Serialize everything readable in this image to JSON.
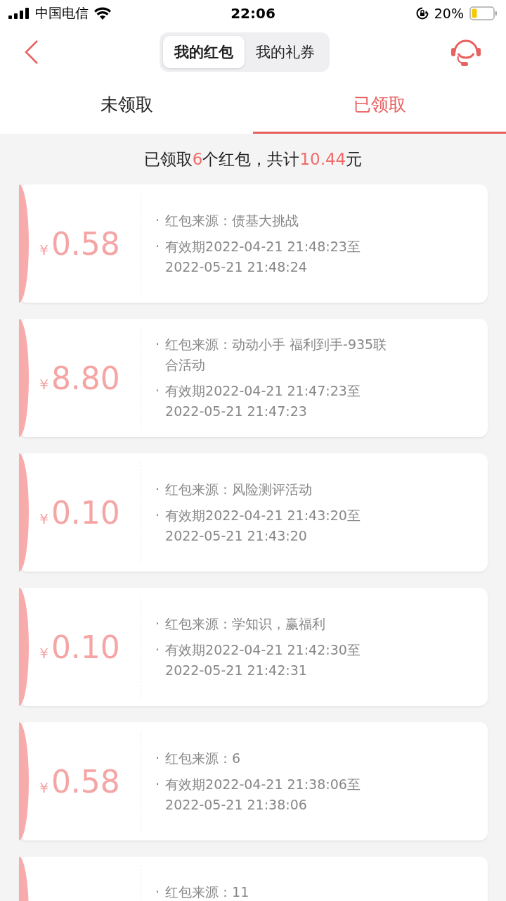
{
  "status_bar": {
    "carrier": "中国电信",
    "time": "22:06",
    "battery": "20%"
  },
  "segments": [
    {
      "label": "我的红包",
      "selected": true
    },
    {
      "label": "我的礼券",
      "selected": false
    }
  ],
  "tabs": [
    {
      "label": "未领取",
      "selected": false
    },
    {
      "label": "已领取",
      "selected": true
    }
  ],
  "summary": [
    {
      "text": "已领取",
      "highlight": false
    },
    {
      "text": "6",
      "highlight": true
    },
    {
      "text": "个红包，共计",
      "highlight": false
    },
    {
      "text": "10.44",
      "highlight": true
    },
    {
      "text": "元",
      "highlight": false
    }
  ],
  "cards": [
    {
      "currency": "¥",
      "amount": "0.58",
      "lines": [
        {
          "bullet": "·",
          "text": "红包来源：债基大挑战"
        },
        {
          "bullet": "·",
          "text": "有效期2022-04-21 21:48:23至 2022-05-21 21:48:24"
        }
      ]
    },
    {
      "currency": "¥",
      "amount": "8.80",
      "lines": [
        {
          "bullet": "·",
          "text": "红包来源：动动小手 福利到手-935联合活动"
        },
        {
          "bullet": "·",
          "text": "有效期2022-04-21 21:47:23至 2022-05-21 21:47:23"
        }
      ]
    },
    {
      "currency": "¥",
      "amount": "0.10",
      "lines": [
        {
          "bullet": "·",
          "text": "红包来源：风险测评活动"
        },
        {
          "bullet": "·",
          "text": "有效期2022-04-21 21:43:20至 2022-05-21 21:43:20"
        }
      ]
    },
    {
      "currency": "¥",
      "amount": "0.10",
      "lines": [
        {
          "bullet": "·",
          "text": "红包来源：学知识，赢福利"
        },
        {
          "bullet": "·",
          "text": "有效期2022-04-21 21:42:30至 2022-05-21 21:42:31"
        }
      ]
    },
    {
      "currency": "¥",
      "amount": "0.58",
      "lines": [
        {
          "bullet": "·",
          "text": "红包来源：6"
        },
        {
          "bullet": "·",
          "text": "有效期2022-04-21 21:38:06至 2022-05-21 21:38:06"
        }
      ]
    },
    {
      "lines": [
        {
          "bullet": "·",
          "text": "红包来源：11"
        }
      ]
    }
  ]
}
